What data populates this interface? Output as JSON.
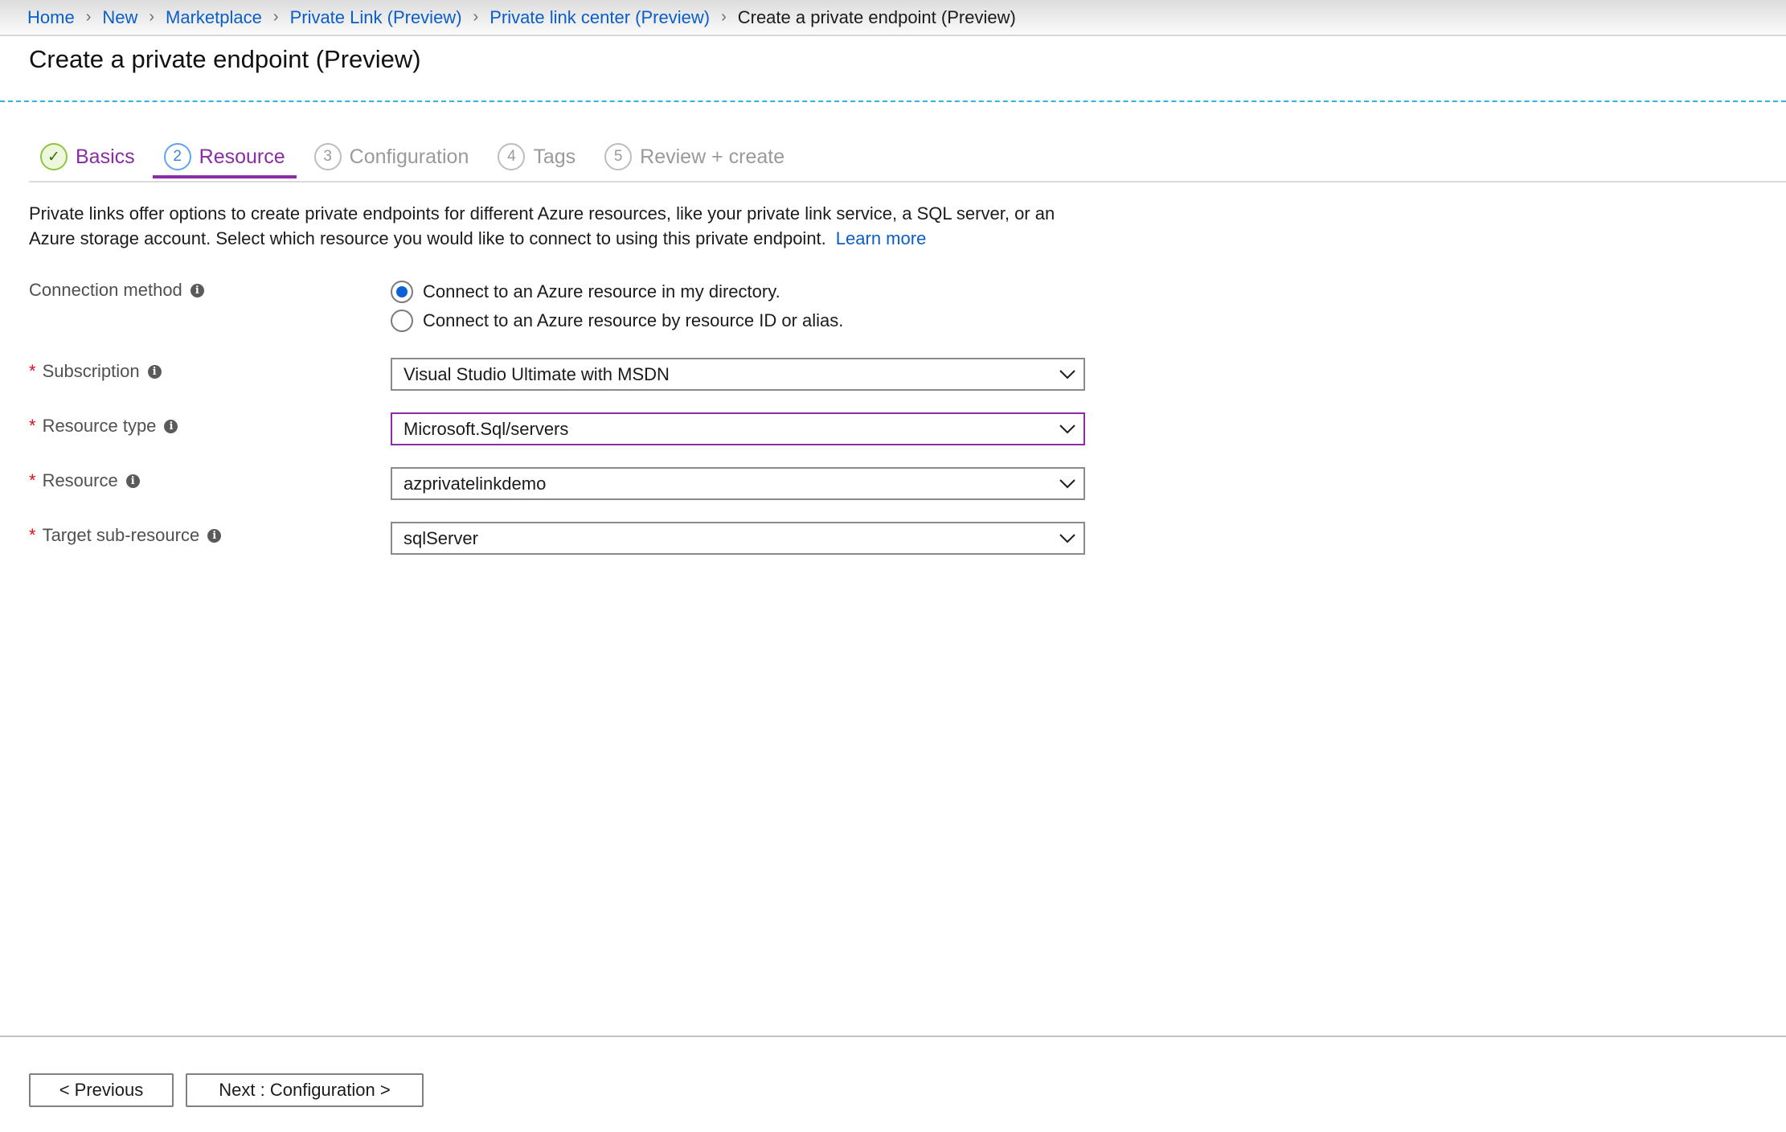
{
  "breadcrumb": {
    "items": [
      "Home",
      "New",
      "Marketplace",
      "Private Link (Preview)",
      "Private link center (Preview)"
    ],
    "current": "Create a private endpoint (Preview)",
    "separator_icon": "chevron-right-icon"
  },
  "page": {
    "title": "Create a private endpoint (Preview)"
  },
  "tabs": [
    {
      "step": "✓",
      "label": "Basics",
      "state": "completed"
    },
    {
      "step": "2",
      "label": "Resource",
      "state": "active"
    },
    {
      "step": "3",
      "label": "Configuration",
      "state": "pending"
    },
    {
      "step": "4",
      "label": "Tags",
      "state": "pending"
    },
    {
      "step": "5",
      "label": "Review + create",
      "state": "pending"
    }
  ],
  "intro": {
    "text": "Private links offer options to create private endpoints for different Azure resources, like your private link service, a SQL server, or an Azure storage account. Select which resource you would like to connect to using this private endpoint.",
    "learn_more": "Learn more"
  },
  "form": {
    "connection_method": {
      "label": "Connection method",
      "options": [
        {
          "label": "Connect to an Azure resource in my directory.",
          "selected": true
        },
        {
          "label": "Connect to an Azure resource by resource ID or alias.",
          "selected": false
        }
      ]
    },
    "subscription": {
      "label": "Subscription",
      "required": "*",
      "value": "Visual Studio Ultimate with MSDN"
    },
    "resource_type": {
      "label": "Resource type",
      "required": "*",
      "value": "Microsoft.Sql/servers"
    },
    "resource": {
      "label": "Resource",
      "required": "*",
      "value": "azprivatelinkdemo"
    },
    "target_sub_resource": {
      "label": "Target sub-resource",
      "required": "*",
      "value": "sqlServer"
    },
    "info_icon": "i"
  },
  "footer": {
    "previous_label": "< Previous",
    "next_label": "Next : Configuration >"
  },
  "colors": {
    "accent": "#8a2ca6",
    "link": "#0a5ec8",
    "required": "#e00b1c",
    "radio_selected": "#0b62d6",
    "completed_step": "#8dc63f"
  }
}
